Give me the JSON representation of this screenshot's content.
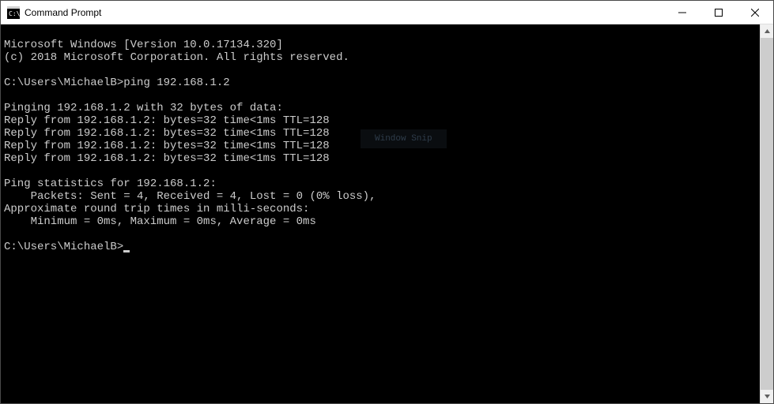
{
  "titlebar": {
    "title": "Command Prompt"
  },
  "terminal": {
    "line1": "Microsoft Windows [Version 10.0.17134.320]",
    "line2": "(c) 2018 Microsoft Corporation. All rights reserved.",
    "blank1": "",
    "prompt1_path": "C:\\Users\\MichaelB>",
    "prompt1_cmd": "ping 192.168.1.2",
    "blank2": "",
    "ping_header": "Pinging 192.168.1.2 with 32 bytes of data:",
    "reply1": "Reply from 192.168.1.2: bytes=32 time<1ms TTL=128",
    "reply2": "Reply from 192.168.1.2: bytes=32 time<1ms TTL=128",
    "reply3": "Reply from 192.168.1.2: bytes=32 time<1ms TTL=128",
    "reply4": "Reply from 192.168.1.2: bytes=32 time<1ms TTL=128",
    "blank3": "",
    "stats1": "Ping statistics for 192.168.1.2:",
    "stats2": "    Packets: Sent = 4, Received = 4, Lost = 0 (0% loss),",
    "stats3": "Approximate round trip times in milli-seconds:",
    "stats4": "    Minimum = 0ms, Maximum = 0ms, Average = 0ms",
    "blank4": "",
    "prompt2_path": "C:\\Users\\MichaelB>"
  },
  "overlay": {
    "window_snip": "Window Snip"
  }
}
